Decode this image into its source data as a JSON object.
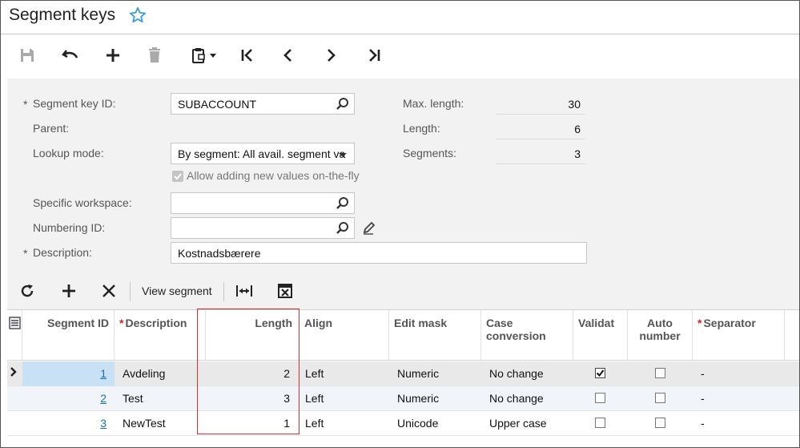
{
  "header": {
    "title": "Segment keys"
  },
  "icons": {
    "favorite": "star-outline-icon",
    "save": "save-icon",
    "undo": "undo-icon",
    "add": "plus-icon",
    "delete": "trash-icon",
    "clipboard": "clipboard-icon",
    "first": "first-page-icon",
    "prev": "chevron-left-icon",
    "next": "chevron-right-icon",
    "last": "last-page-icon",
    "search": "magnifier-icon",
    "edit": "pencil-icon",
    "refresh": "refresh-icon",
    "remove": "x-icon",
    "fit": "fit-columns-icon",
    "excel": "excel-export-icon",
    "grid_menu": "grid-menu-icon",
    "row_pointer": "row-pointer-icon"
  },
  "colors": {
    "accent": "#1a6fb3",
    "star": "#3b9be0",
    "required": "#d22",
    "highlight": "#d9302c",
    "selected_row": "#c9e1f5"
  },
  "form": {
    "segment_key_id": {
      "label": "Segment key ID:",
      "required": "*",
      "value": "SUBACCOUNT"
    },
    "parent": {
      "label": "Parent:"
    },
    "lookup_mode": {
      "label": "Lookup mode:",
      "value": "By segment: All avail. segment va"
    },
    "allow_adding": {
      "label": "Allow adding new values on-the-fly",
      "checked": true
    },
    "specific_workspace": {
      "label": "Specific workspace:",
      "value": ""
    },
    "numbering_id": {
      "label": "Numbering ID:",
      "value": ""
    },
    "description": {
      "label": "Description:",
      "required": "*",
      "value": "Kostnadsbærere"
    },
    "max_length": {
      "label": "Max. length:",
      "value": "30"
    },
    "length": {
      "label": "Length:",
      "value": "6"
    },
    "segments": {
      "label": "Segments:",
      "value": "3"
    }
  },
  "grid_toolbar": {
    "view_segment": "View segment"
  },
  "grid": {
    "columns": [
      {
        "key": "id",
        "label": "Segment ID",
        "required": false
      },
      {
        "key": "desc",
        "label": "Description",
        "required": true
      },
      {
        "key": "length",
        "label": "Length",
        "required": false
      },
      {
        "key": "align",
        "label": "Align",
        "required": false
      },
      {
        "key": "mask",
        "label": "Edit mask",
        "required": false
      },
      {
        "key": "case",
        "label": "Case conversion",
        "required": false
      },
      {
        "key": "validate",
        "label": "Validat",
        "required": false
      },
      {
        "key": "auto",
        "label": "Auto number",
        "required": false
      },
      {
        "key": "sep",
        "label": "Separator",
        "required": true
      }
    ],
    "rows": [
      {
        "id": "1",
        "desc": "Avdeling",
        "length": "2",
        "align": "Left",
        "mask": "Numeric",
        "case": "No change",
        "validate": true,
        "auto": false,
        "sep": "-",
        "selected": true
      },
      {
        "id": "2",
        "desc": "Test",
        "length": "3",
        "align": "Left",
        "mask": "Numeric",
        "case": "No change",
        "validate": false,
        "auto": false,
        "sep": "-",
        "selected": false
      },
      {
        "id": "3",
        "desc": "NewTest",
        "length": "1",
        "align": "Left",
        "mask": "Unicode",
        "case": "Upper case",
        "validate": false,
        "auto": false,
        "sep": "-",
        "selected": false
      }
    ]
  }
}
